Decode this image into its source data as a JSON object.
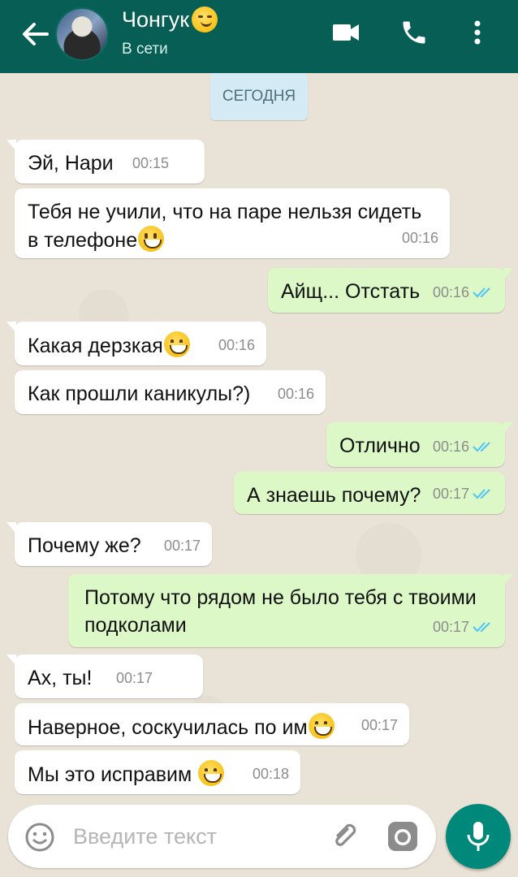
{
  "header": {
    "contact_name": "Чонгук",
    "status": "В сети"
  },
  "date_chip": "СЕГОДНЯ",
  "messages": [
    {
      "text": "Эй, Нари",
      "time": "00:15",
      "dir": "in"
    },
    {
      "text": "Тебя не учили, что на паре нельзя сидеть в телефоне",
      "time": "00:16",
      "dir": "in"
    },
    {
      "text": "Айщ... Отстать",
      "time": "00:16",
      "dir": "out"
    },
    {
      "text": "Какая дерзкая",
      "time": "00:16",
      "dir": "in"
    },
    {
      "text": "Как прошли каникулы?)",
      "time": "00:16",
      "dir": "in"
    },
    {
      "text": "Отлично",
      "time": "00:16",
      "dir": "out"
    },
    {
      "text": "А знаешь почему?",
      "time": "00:17",
      "dir": "out"
    },
    {
      "text": "Почему же?",
      "time": "00:17",
      "dir": "in"
    },
    {
      "text": "Потому что рядом не было тебя с твоими подколами",
      "time": "00:17",
      "dir": "out"
    },
    {
      "text": "Ах, ты!",
      "time": "00:17",
      "dir": "in"
    },
    {
      "text": "Наверное, соскучилась по им",
      "time": "00:17",
      "dir": "in"
    },
    {
      "text": "Мы это исправим",
      "time": "00:18",
      "dir": "in"
    }
  ],
  "input": {
    "placeholder": "Введите текст"
  },
  "colors": {
    "header": "#075e54",
    "incoming": "#ffffff",
    "outgoing": "#dcf8c6",
    "read_ticks": "#4fc3f7",
    "mic_button": "#00897b"
  },
  "icons": [
    "back-arrow-icon",
    "video-call-icon",
    "phone-icon",
    "more-vert-icon",
    "emoji-icon",
    "attach-icon",
    "camera-icon",
    "mic-icon"
  ]
}
